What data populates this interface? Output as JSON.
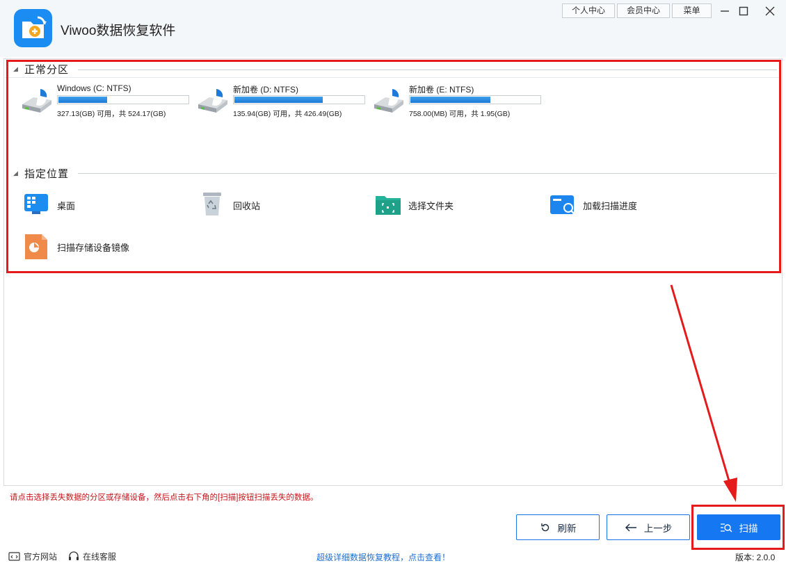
{
  "app": {
    "title": "Viwoo数据恢复软件"
  },
  "top_buttons": {
    "personal": "个人中心",
    "member": "会员中心",
    "menu": "菜单"
  },
  "sections": {
    "partitions": "正常分区",
    "locations": "指定位置"
  },
  "drives": [
    {
      "name": "Windows (C: NTFS)",
      "info": "327.13(GB) 可用，共 524.17(GB)",
      "used_fraction": 0.376
    },
    {
      "name": "新加卷 (D: NTFS)",
      "info": "135.94(GB) 可用，共 426.49(GB)",
      "used_fraction": 0.681
    },
    {
      "name": "新加卷 (E: NTFS)",
      "info": "758.00(MB) 可用，共 1.95(GB)",
      "used_fraction": 0.62
    }
  ],
  "locations": [
    {
      "label": "桌面",
      "icon": "desktop-icon"
    },
    {
      "label": "回收站",
      "icon": "recycle-bin-icon"
    },
    {
      "label": "选择文件夹",
      "icon": "folder-select-icon"
    },
    {
      "label": "加载扫描进度",
      "icon": "load-progress-icon"
    },
    {
      "label": "扫描存储设备镜像",
      "icon": "disk-image-icon"
    }
  ],
  "hint": "请点击选择丢失数据的分区或存储设备，然后点击右下角的[扫描]按钮扫描丢失的数据。",
  "buttons": {
    "refresh": "刷新",
    "back": "上一步",
    "scan": "扫描"
  },
  "footer": {
    "website": "官方网站",
    "support": "在线客服",
    "tutorial": "超级详细数据恢复教程，点击查看！",
    "version": "版本: 2.0.0"
  },
  "colors": {
    "accent": "#1677f2",
    "highlight_red": "#e51a1a",
    "hint_red": "#c4161c"
  }
}
